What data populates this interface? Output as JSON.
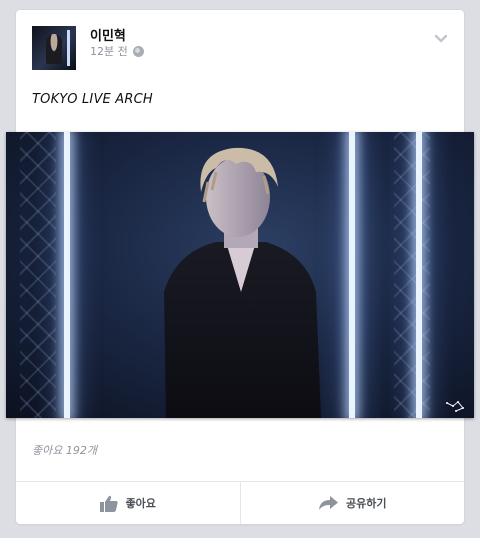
{
  "post": {
    "author": "이민혁",
    "time": "12분 전",
    "privacy_icon": "globe-icon",
    "text": "TOKYO LIVE ARCH",
    "likes_text": "좋아요 192개"
  },
  "actions": {
    "like_label": "좋아요",
    "share_label": "공유하기"
  },
  "colors": {
    "background": "#dcdee3",
    "card": "#ffffff",
    "muted_text": "#8f949c",
    "action_text": "#4b4f56"
  }
}
